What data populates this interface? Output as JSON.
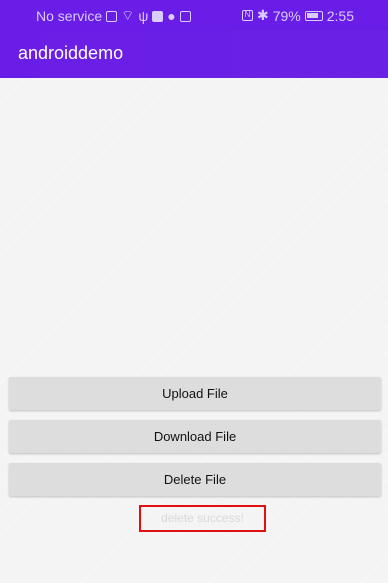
{
  "status_bar": {
    "carrier": "No service",
    "battery_pct": "79%",
    "time": "2:55",
    "icons": [
      "sim-icon",
      "wifi-icon",
      "usb-icon",
      "notification-icon",
      "chat-icon",
      "shield-icon",
      "nfc-icon",
      "bluetooth-icon",
      "battery-icon"
    ]
  },
  "app_bar": {
    "title": "androiddemo"
  },
  "buttons": {
    "upload_label": "Upload File",
    "download_label": "Download File",
    "delete_label": "Delete File"
  },
  "message": {
    "text": "delete success!"
  },
  "colors": {
    "primary": "#6a1de6",
    "button_bg": "#dddddd",
    "highlight_border": "#e01010"
  }
}
